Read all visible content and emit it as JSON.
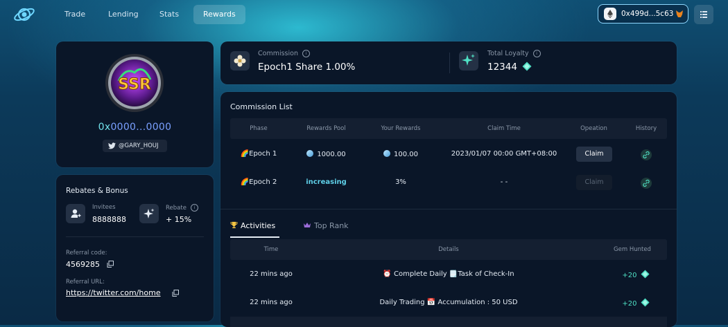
{
  "nav": {
    "tabs": [
      {
        "label": "Trade"
      },
      {
        "label": "Lending"
      },
      {
        "label": "Stats"
      },
      {
        "label": "Rewards"
      }
    ],
    "wallet_address": "0x499d...5c63"
  },
  "profile": {
    "badge_text": "SSR",
    "address_prefix": "0x",
    "address_mid": "0000...0000",
    "twitter_handle": "@GARY_HOUJ"
  },
  "rebates": {
    "title": "Rebates & Bonus",
    "invitees_label": "Invitees",
    "invitees_value": "8888888",
    "rebate_label": "Rebate",
    "rebate_value": "+ 15%",
    "referral_code_label": "Referral code:",
    "referral_code": "4569285",
    "referral_url_label": "Referral URL:",
    "referral_url": "https://twitter.com/home"
  },
  "summary": {
    "commission_label": "Commission",
    "commission_value": "Epoch1 Share 1.00%",
    "loyalty_label": "Total Loyalty",
    "loyalty_value": "12344"
  },
  "commission_list": {
    "title": "Commission List",
    "columns": [
      "Phase",
      "Rewards Pool",
      "Your Rewards",
      "Claim Time",
      "Opeation",
      "History"
    ],
    "rows": [
      {
        "phase": "🌈Epoch 1",
        "pool": "1000.00",
        "rewards": "100.00",
        "claim_time": "2023/01/07 00:00 GMT+08:00",
        "action": "Claim"
      },
      {
        "phase": "🌈Epoch 2",
        "pool": "increasing",
        "rewards": "3%",
        "claim_time": "- -",
        "action": "Claim"
      }
    ]
  },
  "activities": {
    "tab_active": "Activities",
    "tab_other": "Top Rank",
    "columns": [
      "Time",
      "Details",
      "Gem Hunted"
    ],
    "rows": [
      {
        "time": "22 mins ago",
        "details": "⏰ Complete Daily 🗒️Task of Check-In",
        "gems": "+20"
      },
      {
        "time": "22 mins ago",
        "details": "Daily Trading 📅 Accumulation : 50 USD",
        "gems": "+20"
      }
    ]
  },
  "colors": {
    "accent": "#4fe0c4",
    "address": "#70e0ea",
    "increasing": "#5fd0e8"
  }
}
